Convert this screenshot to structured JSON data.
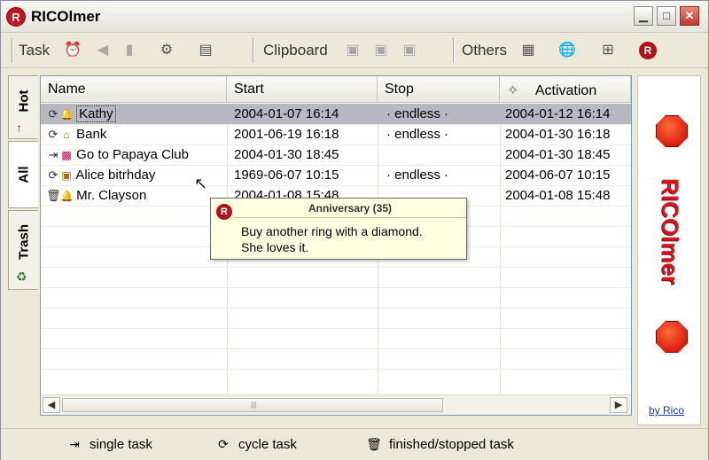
{
  "window": {
    "title": "RICOlmer",
    "logo_letter": "R",
    "min_glyph": "▁",
    "max_glyph": "□",
    "close_glyph": "✕"
  },
  "toolbar": {
    "task_label": "Task",
    "clipboard_label": "Clipboard",
    "others_label": "Others",
    "task_icons": [
      "alarm-icon",
      "back-icon",
      "delete-icon",
      "settings-icon",
      "note-icon"
    ],
    "clipboard_icons": [
      "cut-icon",
      "copy-icon",
      "paste-icon"
    ],
    "others_icons": [
      "calendar-icon",
      "globe-icon",
      "network-icon",
      "rico-icon"
    ]
  },
  "tabs": [
    {
      "label": "Hot",
      "icon": "pin-icon"
    },
    {
      "label": "All",
      "icon": ""
    },
    {
      "label": "Trash",
      "icon": "trash-icon"
    }
  ],
  "list": {
    "columns": {
      "name": "Name",
      "start": "Start",
      "stop": "Stop",
      "activation": "Activation",
      "activation_icon": "✧"
    },
    "rows": [
      {
        "type_icon": "cycle",
        "item_icon": "bell",
        "name": "Kathy",
        "start": "2004-01-07 16:14",
        "stop": "endless",
        "activation": "2004-01-12 16:14",
        "selected": true
      },
      {
        "type_icon": "cycle",
        "item_icon": "bank",
        "name": "Bank",
        "start": "2001-06-19 16:18",
        "stop": "endless",
        "activation": "2004-01-30 16:18",
        "selected": false
      },
      {
        "type_icon": "single",
        "item_icon": "gift",
        "name": "Go to Papaya Club",
        "start": "2004-01-30 18:45",
        "stop": "",
        "activation": "2004-01-30 18:45",
        "selected": false
      },
      {
        "type_icon": "cycle",
        "item_icon": "box",
        "name": "Alice bitrhday",
        "start": "1969-06-07 10:15",
        "stop": "endless",
        "activation": "2004-06-07 10:15",
        "selected": false
      },
      {
        "type_icon": "finished",
        "item_icon": "bell",
        "name": "Mr. Clayson",
        "start": "2004-01-08 15:48",
        "stop": "",
        "activation": "2004-01-08 15:48",
        "selected": false
      }
    ]
  },
  "tooltip": {
    "logo_letter": "R",
    "title": "Anniversary (35)",
    "line1": "Buy another ring with a diamond.",
    "line2": "She loves it."
  },
  "brand": {
    "text": "RICOlmer",
    "link": "by Rico"
  },
  "legend": [
    {
      "icon": "single-task-icon",
      "label": "single task"
    },
    {
      "icon": "cycle-task-icon",
      "label": "cycle task"
    },
    {
      "icon": "finished-task-icon",
      "label": "finished/stopped task"
    }
  ],
  "colors": {
    "brand_red": "#d9161c",
    "selection": "#b7b8c0",
    "tooltip_bg": "#ffffe1"
  }
}
